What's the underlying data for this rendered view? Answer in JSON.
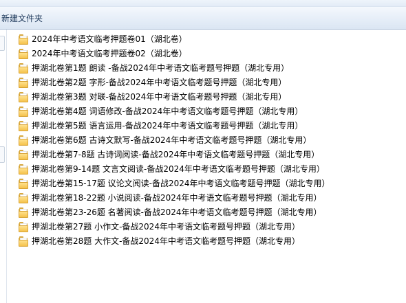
{
  "toolbar": {
    "new_folder_label": "新建文件夹"
  },
  "files": [
    {
      "name": "2024年中考语文临考押题卷01（湖北卷）",
      "icon": "folder-icon"
    },
    {
      "name": "2024年中考语文临考押题卷02（湖北卷）",
      "icon": "folder-icon"
    },
    {
      "name": "押湖北卷第1题 朗读 -备战2024年中考语文临考题号押题（湖北专用）",
      "icon": "folder-icon"
    },
    {
      "name": "押湖北卷第2题 字形-备战2024年中考语文临考题号押题（湖北专用）",
      "icon": "folder-icon"
    },
    {
      "name": "押湖北卷第3题 对联-备战2024年中考语文临考题号押题（湖北专用）",
      "icon": "folder-icon"
    },
    {
      "name": "押湖北卷第4题 词语修改-备战2024年中考语文临考题号押题（湖北专用）",
      "icon": "folder-icon"
    },
    {
      "name": "押湖北卷第5题 语言运用-备战2024年中考语文临考题号押题（湖北专用）",
      "icon": "folder-icon"
    },
    {
      "name": "押湖北卷第6题 古诗文默写-备战2024年中考语文临考题号押题（湖北专用）",
      "icon": "folder-icon"
    },
    {
      "name": "押湖北卷第7-8题 古诗词阅读-备战2024年中考语文临考题号押题（湖北专用）",
      "icon": "folder-icon"
    },
    {
      "name": "押湖北卷第9-14题 文言文阅读-备战2024年中考语文临考题号押题（湖北专用）",
      "icon": "folder-icon"
    },
    {
      "name": "押湖北卷第15-17题 议论文阅读-备战2024年中考语文临考题号押题（湖北专用）",
      "icon": "folder-icon"
    },
    {
      "name": "押湖北卷第18-22题 小说阅读-备战2024年中考语文临考题号押题（湖北专用）",
      "icon": "folder-icon"
    },
    {
      "name": "押湖北卷第23-26题 名著阅读-备战2024年中考语文临考题号押题（湖北专用）",
      "icon": "folder-icon"
    },
    {
      "name": "押湖北卷第27题 小作文-备战2024年中考语文临考题号押题（湖北专用）",
      "icon": "folder-icon"
    },
    {
      "name": "押湖北卷第28题 大作文-备战2024年中考语文临考题号押题（湖北专用）",
      "icon": "folder-icon"
    }
  ]
}
